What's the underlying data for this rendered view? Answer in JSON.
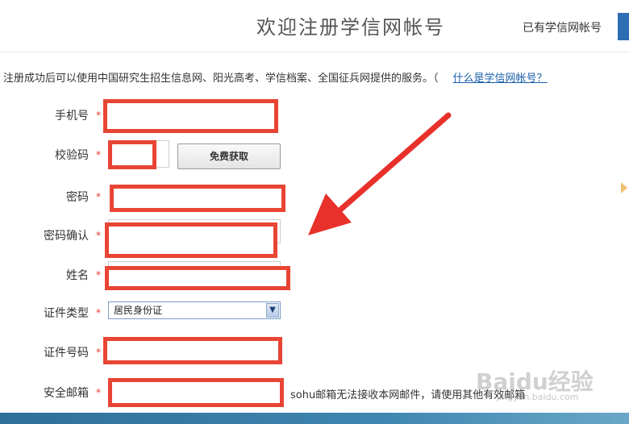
{
  "header": {
    "title": "欢迎注册学信网帐号",
    "login_link": "已有学信网帐号"
  },
  "intro": {
    "text": "注册成功后可以使用中国研究生招生信息网、阳光高考、学信档案、全国征兵网提供的服务。",
    "paren_open": "（",
    "help_link": "什么是学信网帐号？"
  },
  "form": {
    "required_mark": "*",
    "phone_label": "手机号",
    "code_label": "校验码",
    "code_button": "免费获取",
    "password_label": "密码",
    "password_confirm_label": "密码确认",
    "name_label": "姓名",
    "id_type_label": "证件类型",
    "id_type_value": "居民身份证",
    "id_number_label": "证件号码",
    "email_label": "安全邮箱",
    "email_note": "sohu邮箱无法接收本网邮件，请使用其他有效邮箱"
  },
  "watermark": {
    "brand": "Baidu经验",
    "url": "jingyan.baidu.com"
  },
  "colors": {
    "highlight_red": "#e84534",
    "arrow_red": "#e8312a",
    "link_blue": "#1a5fa8"
  }
}
